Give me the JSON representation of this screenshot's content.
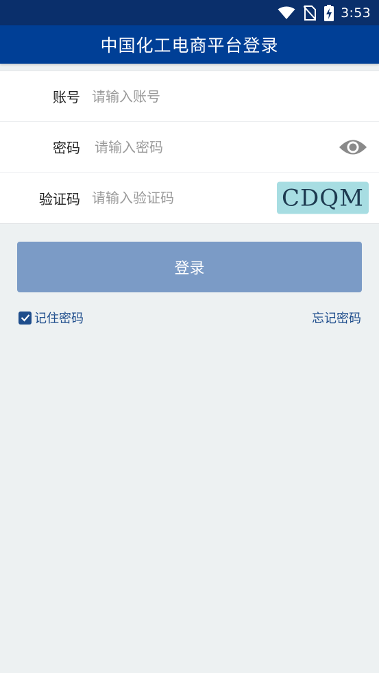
{
  "status_bar": {
    "time": "3:53",
    "icons": [
      "wifi-icon",
      "no-sim-icon",
      "battery-charging-icon"
    ]
  },
  "app_bar": {
    "title": "中国化工电商平台登录"
  },
  "form": {
    "account": {
      "label": "账号",
      "placeholder": "请输入账号",
      "value": ""
    },
    "password": {
      "label": "密码",
      "placeholder": "请输入密码",
      "value": "",
      "toggle_icon": "eye-icon"
    },
    "captcha": {
      "label": "验证码",
      "placeholder": "请输入验证码",
      "value": "",
      "image_text": "CDQM"
    }
  },
  "login_button": {
    "label": "登录"
  },
  "options": {
    "remember_password": {
      "label": "记住密码",
      "checked": true
    },
    "forgot_password": {
      "label": "忘记密码"
    }
  },
  "colors": {
    "status_bar": "#0a2f6b",
    "app_bar": "#003f96",
    "button": "#7b9bc6",
    "link": "#1e4d8c",
    "background": "#edf1f2",
    "captcha_bg": "#a7dde2"
  }
}
